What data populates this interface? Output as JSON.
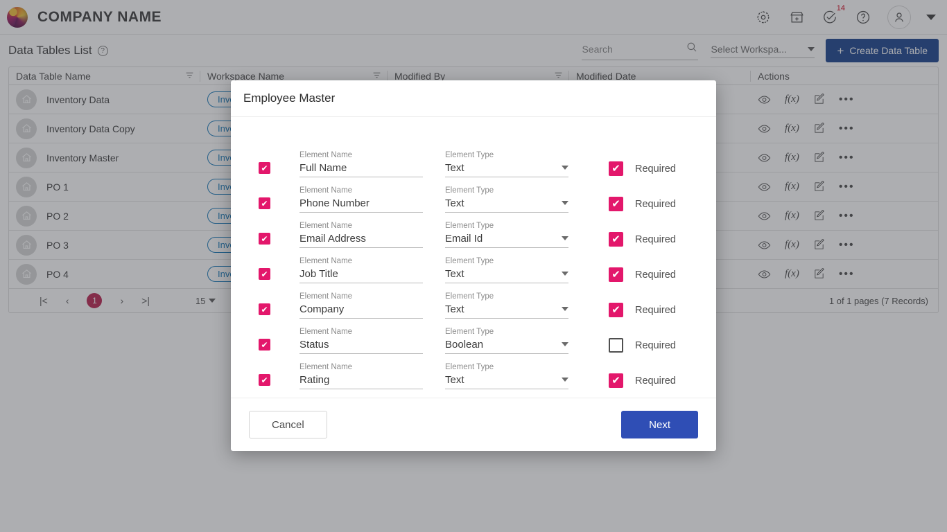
{
  "topbar": {
    "company_name": "COMPANY NAME",
    "icons": [
      {
        "name": "settings-gear-icon"
      },
      {
        "name": "marketplace-store-icon"
      },
      {
        "name": "tasks-check-icon",
        "badge": "14"
      },
      {
        "name": "help-question-icon"
      },
      {
        "name": "user-avatar-icon"
      },
      {
        "name": "account-chevron-down-icon"
      }
    ]
  },
  "header": {
    "title": "Data Tables List",
    "help_icon": "help-question-icon",
    "search": {
      "placeholder": "Search",
      "value": "",
      "icon": "search-icon"
    },
    "workspace_select": {
      "value": "Select Workspa...",
      "icon": "chevron-down-icon"
    },
    "create_button": {
      "label": "Create Data Table",
      "icon": "plus-icon",
      "color": "#17418c"
    }
  },
  "table": {
    "columns": [
      {
        "label": "Data Table Name",
        "filter_icon": "filter-icon"
      },
      {
        "label": "Workspace Name",
        "filter_icon": "filter-icon"
      },
      {
        "label": "Modified By",
        "filter_icon": "filter-icon"
      },
      {
        "label": "Modified Date",
        "filter_icon": "filter-icon"
      },
      {
        "label": "Actions",
        "filter_icon": ""
      }
    ],
    "rows": [
      {
        "name": "Inventory Data",
        "workspace": "Inven",
        "icon": "home-icon"
      },
      {
        "name": "Inventory Data Copy",
        "workspace": "Inven",
        "icon": "home-icon"
      },
      {
        "name": "Inventory Master",
        "workspace": "Inven",
        "icon": "home-icon"
      },
      {
        "name": "PO 1",
        "workspace": "Inven",
        "icon": "home-icon"
      },
      {
        "name": "PO 2",
        "workspace": "Inven",
        "icon": "home-icon"
      },
      {
        "name": "PO 3",
        "workspace": "Inven",
        "icon": "home-icon"
      },
      {
        "name": "PO 4",
        "workspace": "Inven",
        "icon": "home-icon"
      }
    ],
    "row_actions": [
      {
        "name": "view-eye-icon",
        "label": ""
      },
      {
        "name": "formula-fx-icon",
        "label": "f(x)"
      },
      {
        "name": "edit-pencil-icon",
        "label": ""
      },
      {
        "name": "more-options-icon",
        "label": "•••"
      }
    ],
    "footer": {
      "first_page": "|<",
      "prev_page": "‹",
      "current_page": "1",
      "next_page": "›",
      "last_page": ">|",
      "page_size": "15",
      "records_text": "1 of 1 pages (7 Records)"
    }
  },
  "modal": {
    "title": "Employee Master",
    "labels": {
      "element_name": "Element Name",
      "element_type": "Element Type",
      "required": "Required"
    },
    "elements": [
      {
        "selected": true,
        "name": "Full Name",
        "type": "Text",
        "required": true
      },
      {
        "selected": true,
        "name": "Phone Number",
        "type": "Text",
        "required": true
      },
      {
        "selected": true,
        "name": "Email Address",
        "type": "Email Id",
        "required": true
      },
      {
        "selected": true,
        "name": "Job Title",
        "type": "Text",
        "required": true
      },
      {
        "selected": true,
        "name": "Company",
        "type": "Text",
        "required": true
      },
      {
        "selected": true,
        "name": "Status",
        "type": "Boolean",
        "required": false
      },
      {
        "selected": true,
        "name": "Rating",
        "type": "Text",
        "required": true
      }
    ],
    "cancel_label": "Cancel",
    "next_label": "Next",
    "accent_checkbox": "#e3176b",
    "primary_button": "#2f4eb5"
  }
}
